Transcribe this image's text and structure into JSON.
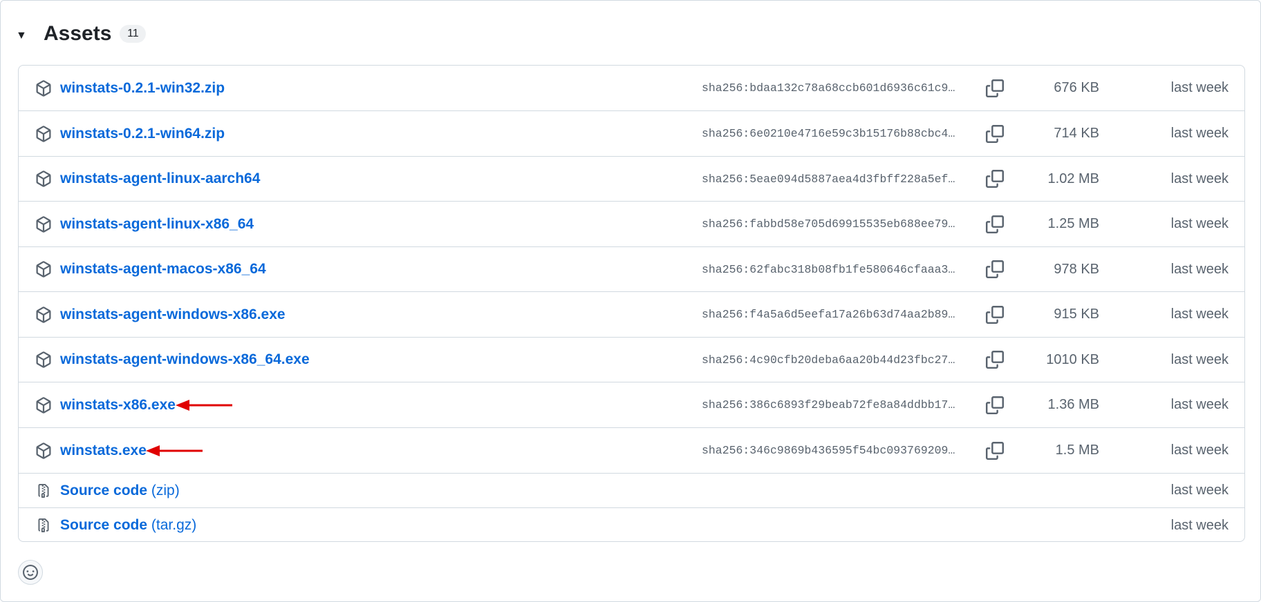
{
  "assets": {
    "title": "Assets",
    "count": "11"
  },
  "files": [
    {
      "name": "winstats-0.2.1-win32.zip",
      "sha": "sha256:bdaa132c78a68ccb601d6936c61c9…",
      "size": "676 KB",
      "date": "last week"
    },
    {
      "name": "winstats-0.2.1-win64.zip",
      "sha": "sha256:6e0210e4716e59c3b15176b88cbc4…",
      "size": "714 KB",
      "date": "last week"
    },
    {
      "name": "winstats-agent-linux-aarch64",
      "sha": "sha256:5eae094d5887aea4d3fbff228a5ef…",
      "size": "1.02 MB",
      "date": "last week"
    },
    {
      "name": "winstats-agent-linux-x86_64",
      "sha": "sha256:fabbd58e705d69915535eb688ee79…",
      "size": "1.25 MB",
      "date": "last week"
    },
    {
      "name": "winstats-agent-macos-x86_64",
      "sha": "sha256:62fabc318b08fb1fe580646cfaaa3…",
      "size": "978 KB",
      "date": "last week"
    },
    {
      "name": "winstats-agent-windows-x86.exe",
      "sha": "sha256:f4a5a6d5eefa17a26b63d74aa2b89…",
      "size": "915 KB",
      "date": "last week"
    },
    {
      "name": "winstats-agent-windows-x86_64.exe",
      "sha": "sha256:4c90cfb20deba6aa20b44d23fbc27…",
      "size": "1010 KB",
      "date": "last week"
    },
    {
      "name": "winstats-x86.exe",
      "sha": "sha256:386c6893f29beab72fe8a84ddbb17…",
      "size": "1.36 MB",
      "date": "last week"
    },
    {
      "name": "winstats.exe",
      "sha": "sha256:346c9869b436595f54bc093769209…",
      "size": "1.5 MB",
      "date": "last week"
    }
  ],
  "source": [
    {
      "label": "Source code",
      "format": "(zip)",
      "date": "last week"
    },
    {
      "label": "Source code",
      "format": "(tar.gz)",
      "date": "last week"
    }
  ],
  "icons": {
    "package": "package-icon",
    "zip": "file-zip-icon",
    "copy": "copy-icon",
    "caret": "triangle-down-icon",
    "reaction": "smiley-icon",
    "annotation": "red-arrow"
  },
  "colors": {
    "link": "#0969da",
    "muted": "#59636e",
    "border": "#d1d9e0",
    "annotation_arrow": "#e00000"
  }
}
